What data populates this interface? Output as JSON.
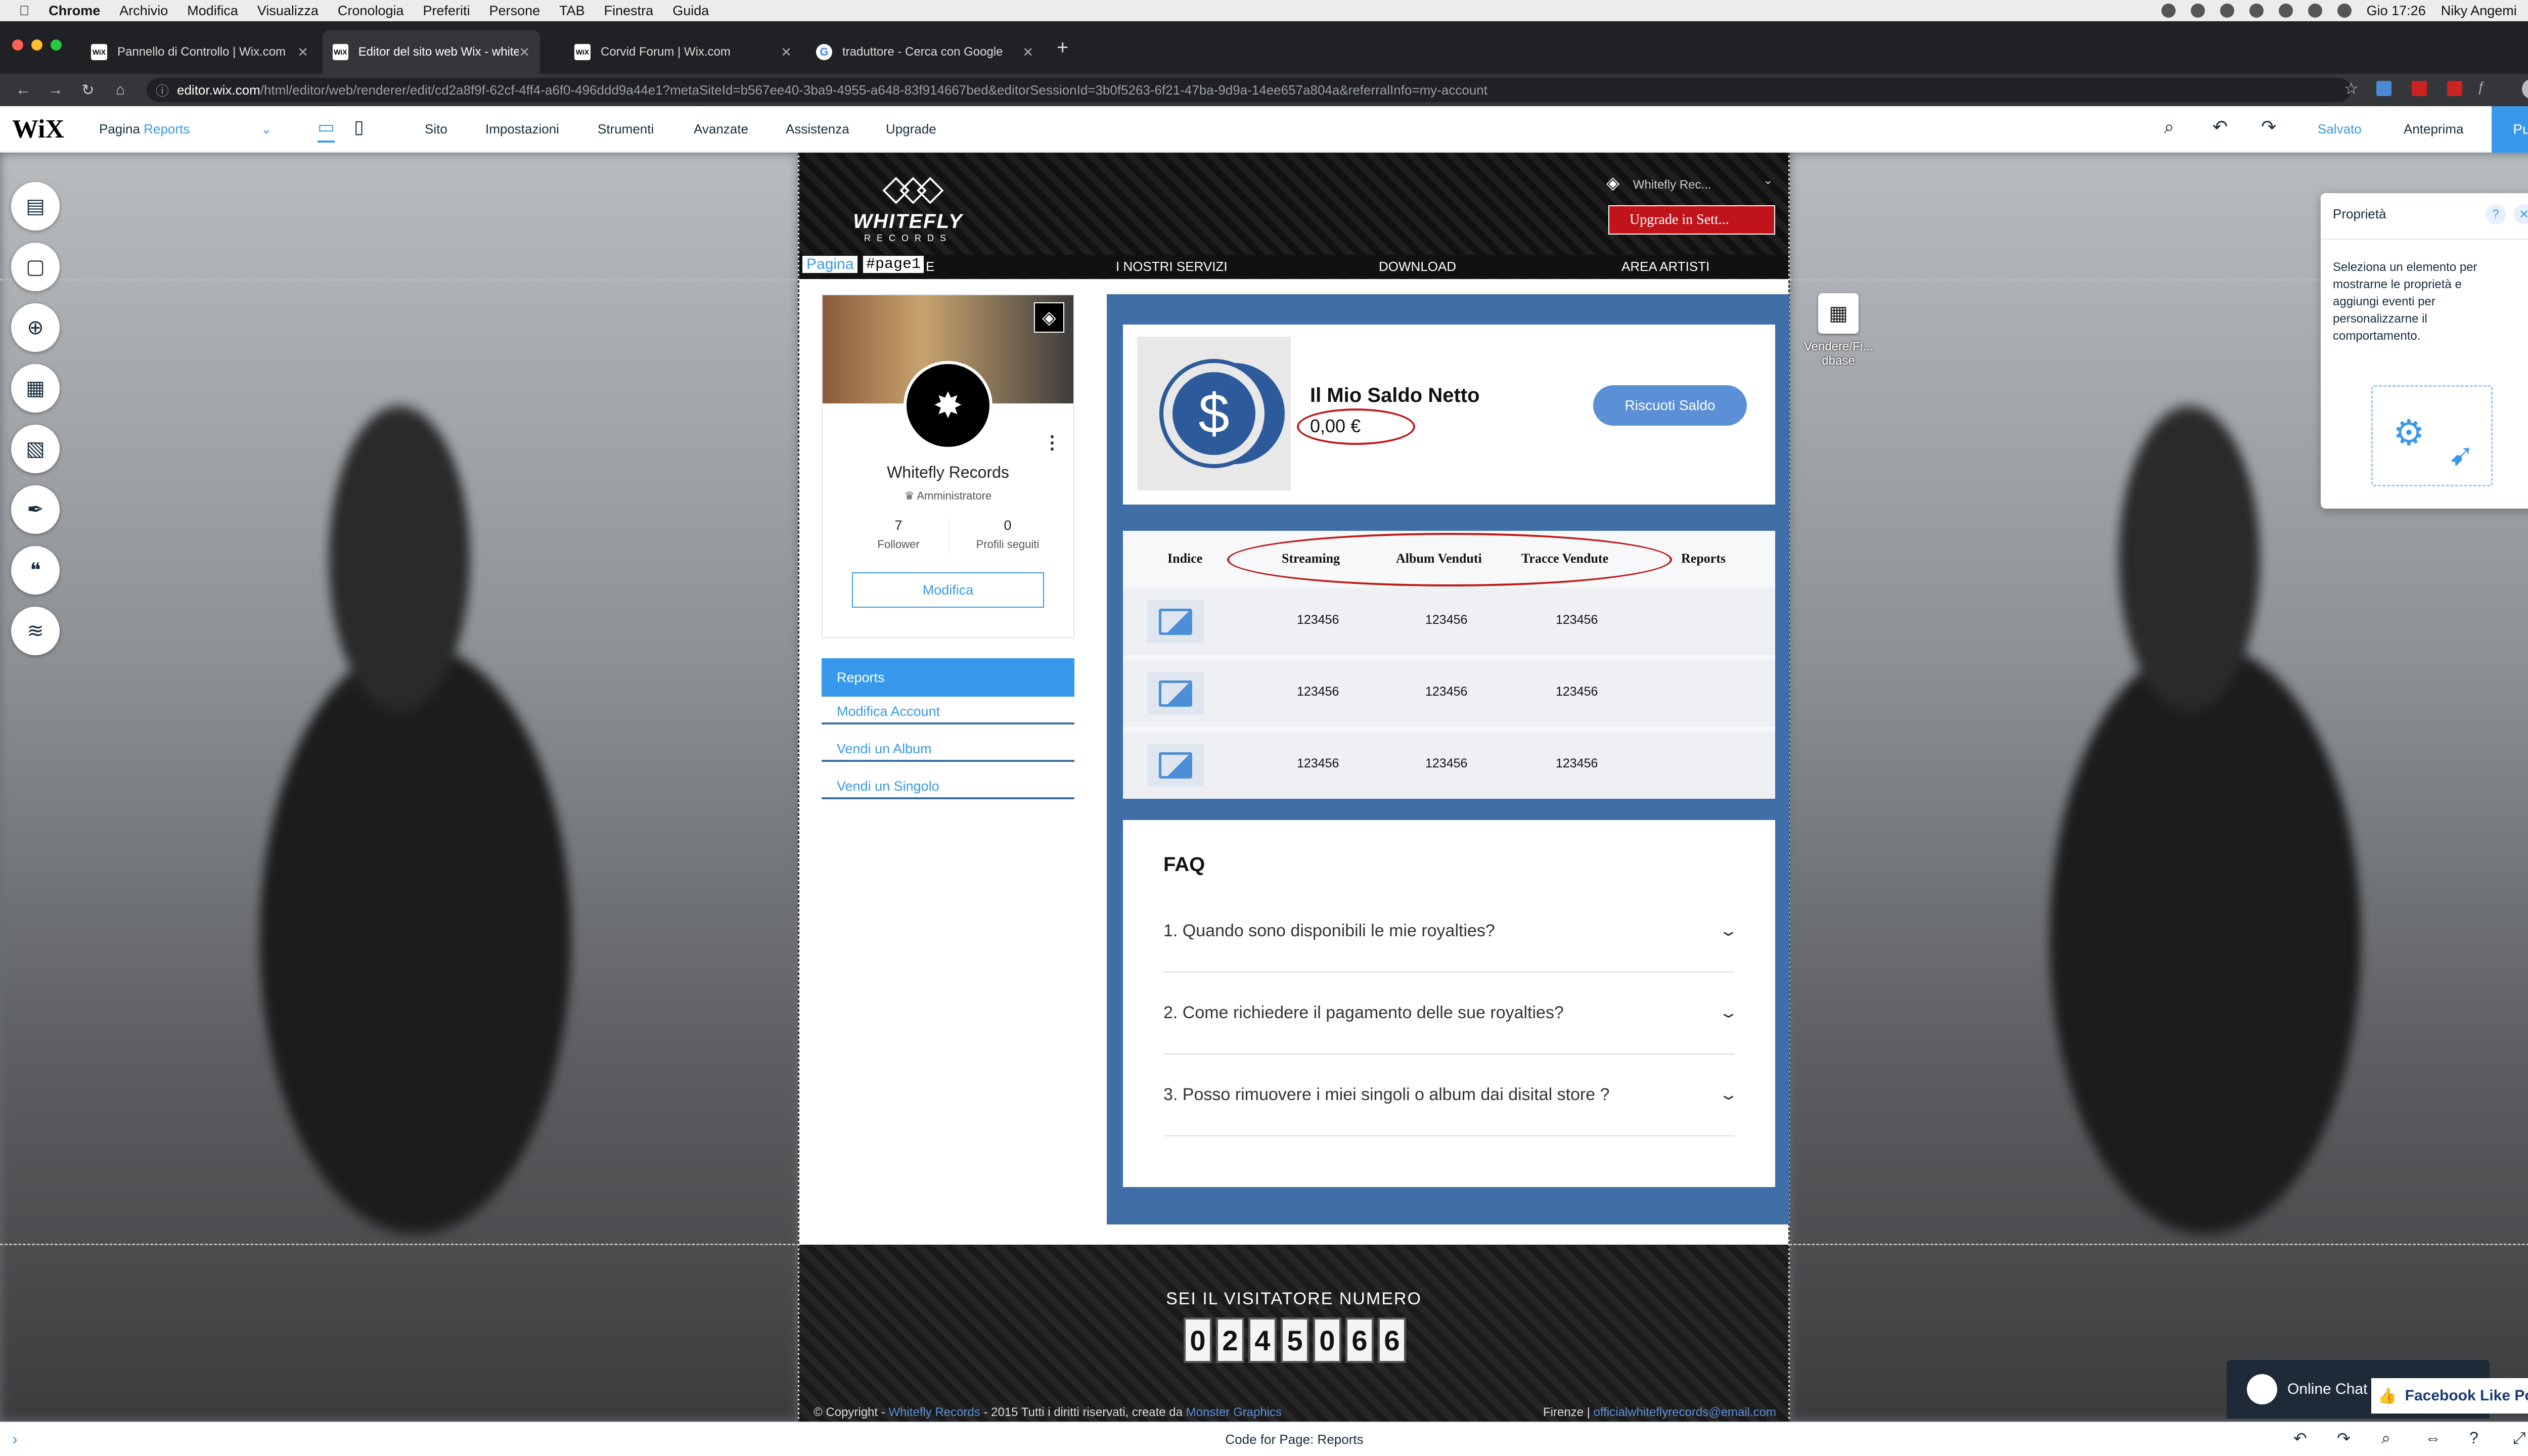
{
  "menubar": {
    "items": [
      "Chrome",
      "Archivio",
      "Modifica",
      "Visualizza",
      "Cronologia",
      "Preferiti",
      "Persone",
      "TAB",
      "Finestra",
      "Guida"
    ],
    "clock": "Gio 17:26",
    "user": "Niky Angemi"
  },
  "tabs": [
    {
      "title": "Pannello di Controllo | Wix.com",
      "favicon": "WiX"
    },
    {
      "title": "Editor del sito web Wix - whitefly",
      "favicon": "WiX"
    },
    {
      "title": "Corvid Forum | Wix.com",
      "favicon": "WiX"
    },
    {
      "title": "traduttore - Cerca con Google",
      "favicon": "G"
    }
  ],
  "new_tab": "+",
  "address": {
    "host": "editor.wix.com",
    "path": "/html/editor/web/renderer/edit/cd2a8f9f-62cf-4ff4-a6f0-496ddd9a44e1?metaSiteId=b567ee40-3ba9-4955-a648-83f914667bed&editorSessionId=3b0f5263-6f21-47ba-9d9a-14ee657a804a&referralInfo=my-account"
  },
  "wix_bar": {
    "logo": "WiX",
    "page_label": "Pagina",
    "page_name": "Reports",
    "menu": [
      "Sito",
      "Impostazioni",
      "Strumenti",
      "Avanzate",
      "Assistenza",
      "Upgrade"
    ],
    "saved": "Salvato",
    "preview": "Anteprima",
    "publish": "Pubblica"
  },
  "site": {
    "logo_name": "WHITEFLY",
    "logo_sub": "RECORDS",
    "member_name": "Whitefly Rec...",
    "upgrade": "Upgrade in Sett...",
    "nav": [
      "I NOSTRI SERVIZI",
      "DOWNLOAD",
      "AREA ARTISTI"
    ],
    "nav_partial": "E",
    "page_tag": "Pagina",
    "page_id": "#page1"
  },
  "profile": {
    "name": "Whitefly Records",
    "role": "Amministratore",
    "followers": "7",
    "followers_label": "Follower",
    "following": "0",
    "following_label": "Profili seguiti",
    "edit": "Modifica"
  },
  "side_menu": [
    "Reports",
    "Modifica Account",
    "Vendi un Album",
    "Vendi un Singolo"
  ],
  "balance": {
    "title": "Il Mio Saldo Netto",
    "value": "0,00 €",
    "button": "Riscuoti Saldo"
  },
  "table": {
    "headers": [
      "Indice",
      "Streaming",
      "Album Venduti",
      "Tracce Vendute",
      "Reports"
    ],
    "rows": [
      [
        "123456",
        "123456",
        "123456"
      ],
      [
        "123456",
        "123456",
        "123456"
      ],
      [
        "123456",
        "123456",
        "123456"
      ]
    ]
  },
  "faq": {
    "title": "FAQ",
    "items": [
      "1. Quando sono disponibili le mie royalties?",
      "2. Come richiedere il pagamento delle sue royalties?",
      "3. Posso rimuovere i miei singoli o album dai disital store ?"
    ]
  },
  "footer": {
    "visitor_label": "SEI IL VISITATORE NUMERO",
    "digits": [
      "0",
      "2",
      "4",
      "5",
      "0",
      "6",
      "6"
    ],
    "copyright_pre": "© Copyright - ",
    "copyright_link": "Whitefly Records",
    "copyright_mid": " - 2015 Tutti i diritti riservati, create da ",
    "copyright_link2": "Monster Graphics",
    "contact_pre": "Firenze | ",
    "contact_email": "officialwhiteflyrecords@email.com"
  },
  "props_panel": {
    "title": "Proprietà",
    "help": "?",
    "body": "Seleziona un elemento per mostrarne le proprietà e aggiungi eventi per personalizzarne il comportamento."
  },
  "widget_label": "Vendere/Fi... dbase",
  "chat": "Online Chat",
  "fb_popup": "Facebook Like Popup",
  "bottom_bar": "Code for Page: Reports",
  "colors": {
    "accent": "#3899ec",
    "site_blue": "#3f6fa6",
    "highlight_red": "#c01818"
  }
}
